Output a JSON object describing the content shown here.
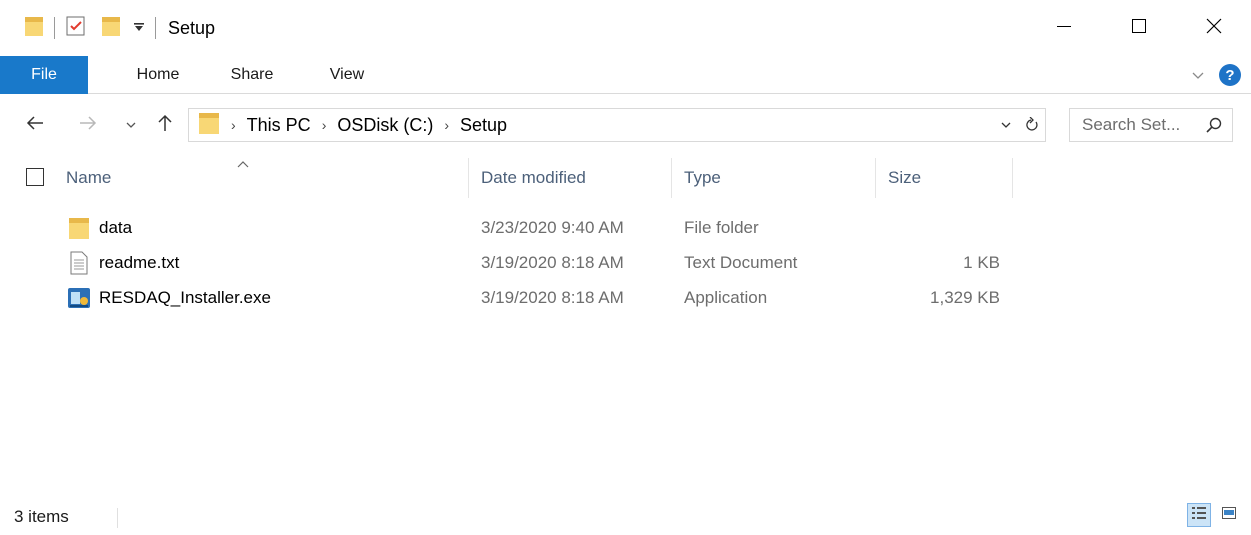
{
  "window": {
    "title": "Setup",
    "controls": {
      "minimize": "minimize-icon",
      "maximize": "maximize-icon",
      "close": "close-icon"
    }
  },
  "ribbon": {
    "tabs": [
      {
        "label": "File",
        "active": true
      },
      {
        "label": "Home"
      },
      {
        "label": "Share"
      },
      {
        "label": "View"
      }
    ],
    "accent_color": "#1979ca"
  },
  "address": {
    "breadcrumbs": [
      "This PC",
      "OSDisk (C:)",
      "Setup"
    ],
    "search_placeholder": "Search Set..."
  },
  "columns": [
    "Name",
    "Date modified",
    "Type",
    "Size"
  ],
  "files": [
    {
      "name": "data",
      "date": "3/23/2020 9:40 AM",
      "type": "File folder",
      "size": "",
      "icon": "folder-icon"
    },
    {
      "name": "readme.txt",
      "date": "3/19/2020 8:18 AM",
      "type": "Text Document",
      "size": "1 KB",
      "icon": "text-file-icon"
    },
    {
      "name": "RESDAQ_Installer.exe",
      "date": "3/19/2020 8:18 AM",
      "type": "Application",
      "size": "1,329 KB",
      "icon": "installer-icon"
    }
  ],
  "status": {
    "item_count": "3 items"
  }
}
